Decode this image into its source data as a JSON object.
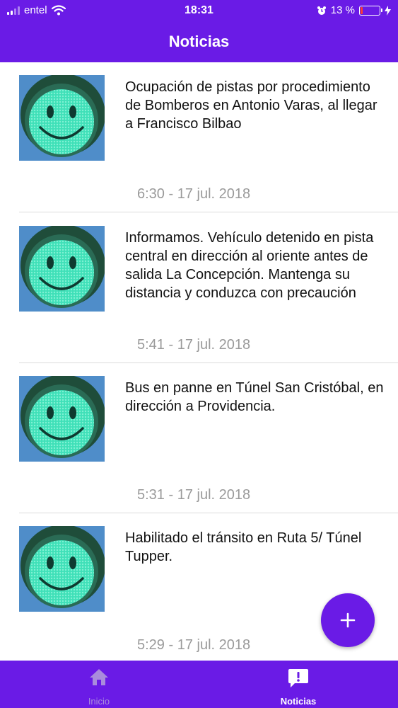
{
  "status_bar": {
    "carrier": "entel",
    "time": "18:31",
    "battery_percent": "13 %",
    "battery_level": 0.13,
    "battery_color": "#ff3b30"
  },
  "header": {
    "title": "Noticias"
  },
  "news": [
    {
      "text": "Ocupación de pistas por procedimiento de Bomberos en Antonio Varas, al llegar a Francisco Bilbao",
      "date": "6:30 - 17 jul. 2018"
    },
    {
      "text": "Informamos. Vehículo detenido en pista central en dirección al oriente antes de salida La Concepción. Mantenga su distancia y conduzca con precaución",
      "date": "5:41 - 17 jul. 2018"
    },
    {
      "text": "Bus en panne en Túnel San Cristóbal, en dirección a Providencia.",
      "date": "5:31 - 17 jul. 2018"
    },
    {
      "text": "Habilitado el tránsito en Ruta 5/ Túnel Tupper.",
      "date": "5:29 - 17 jul. 2018"
    }
  ],
  "fab": {
    "label": "+",
    "icon": "plus-icon"
  },
  "tabs": [
    {
      "label": "Inicio",
      "icon": "home-icon",
      "active": false
    },
    {
      "label": "Noticias",
      "icon": "exclamation-bubble-icon",
      "active": true
    }
  ],
  "colors": {
    "primary": "#6a1be6",
    "thumb_bg": "#4f8dc9",
    "smiley_green": "#3fe0b8",
    "date_gray": "#9a9a9a"
  }
}
